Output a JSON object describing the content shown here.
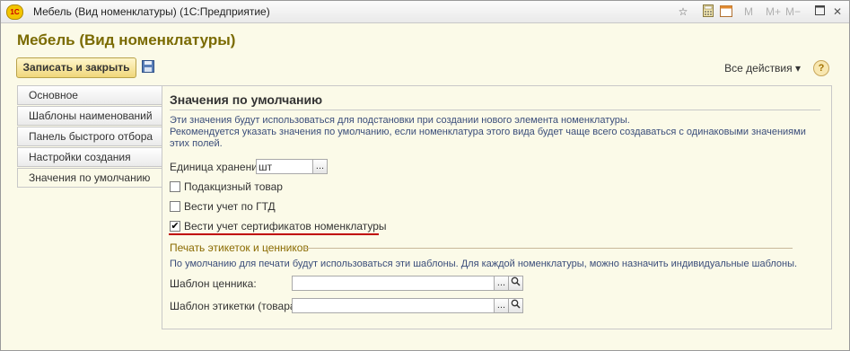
{
  "window": {
    "title": "Мебель (Вид номенклатуры)  (1С:Предприятие)",
    "logo_text": "1С"
  },
  "titlebar_buttons": {
    "m": "M",
    "mplus": "M+",
    "mminus": "M−"
  },
  "form": {
    "title": "Мебель (Вид номенклатуры)"
  },
  "toolbar": {
    "save_close_label": "Записать и закрыть",
    "all_actions_label": "Все действия ▾",
    "help_label": "?"
  },
  "tabs": [
    {
      "label": "Основное"
    },
    {
      "label": "Шаблоны наименований"
    },
    {
      "label": "Панель быстрого отбора"
    },
    {
      "label": "Настройки создания"
    },
    {
      "label": "Значения по умолчанию"
    }
  ],
  "section": {
    "title": "Значения по умолчанию",
    "desc_line1": "Эти значения будут использоваться для подстановки при создании нового элемента номенклатуры.",
    "desc_line2": "Рекомендуется указать значения по умолчанию, если номенклатура этого вида будет чаще всего создаваться с одинаковыми значениями этих полей."
  },
  "fields": {
    "unit": {
      "label": "Единица хранения:",
      "value": "шт"
    },
    "excise": {
      "label": "Подакцизный товар",
      "checked": false
    },
    "gtd": {
      "label": "Вести учет по ГТД",
      "checked": false
    },
    "certs": {
      "label": "Вести учет сертификатов номенклатуры",
      "checked": true
    }
  },
  "print_group": {
    "title": "Печать этикеток и ценников",
    "desc": "По умолчанию для печати будут использоваться эти шаблоны. Для каждой номенклатуры, можно назначить индивидуальные шаблоны.",
    "price_template": {
      "label": "Шаблон ценника:",
      "value": ""
    },
    "label_template": {
      "label": "Шаблон этикетки (товара):",
      "value": ""
    }
  },
  "accent_colors": {
    "title": "#7a6a00",
    "highlight": "#c00000",
    "desc_text": "#3a4d7a",
    "button": "#f0d77a"
  }
}
